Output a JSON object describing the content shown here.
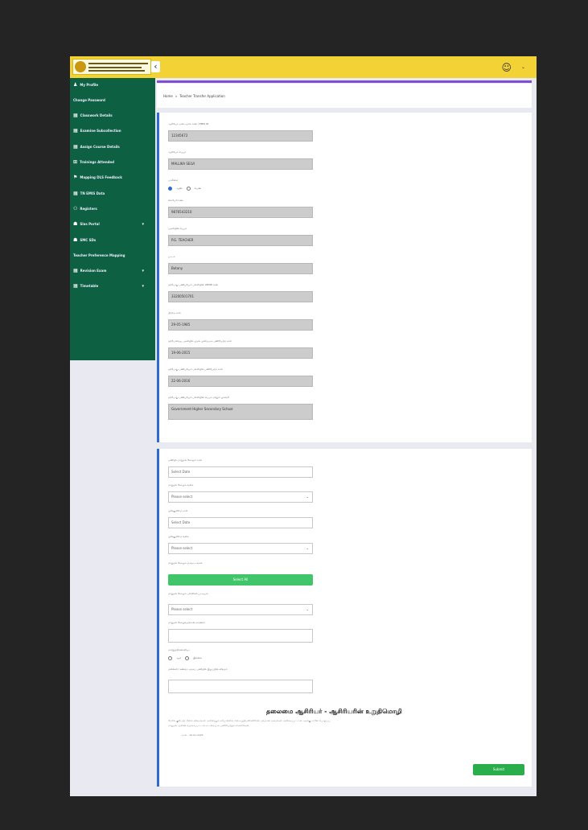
{
  "header": {
    "collapse_icon": "chevron-left-icon",
    "user_icon": "user-circle-icon",
    "user_name": "",
    "user_menu_icon": "chevron-down-icon"
  },
  "sidebar": {
    "items": [
      {
        "label": "My Profile",
        "icon": "user-icon",
        "has_chevron": false
      },
      {
        "label": "Change Password",
        "icon": "",
        "has_chevron": false
      },
      {
        "label": "Classwork Details",
        "icon": "list-icon",
        "has_chevron": false
      },
      {
        "label": "Examine Subcollection",
        "icon": "list-icon",
        "has_chevron": false
      },
      {
        "label": "Assign Course Details",
        "icon": "list-icon",
        "has_chevron": false
      },
      {
        "label": "Trainings Attended",
        "icon": "grid-icon",
        "has_chevron": false
      },
      {
        "label": "Mapping DLS Feedback",
        "icon": "flag-icon",
        "has_chevron": false
      },
      {
        "label": "TN EMIS Data",
        "icon": "list-icon",
        "has_chevron": false
      },
      {
        "label": "Registers",
        "icon": "users-icon",
        "has_chevron": false
      },
      {
        "label": "Slas Portal",
        "icon": "cap-icon",
        "has_chevron": true
      },
      {
        "label": "SMC SDs",
        "icon": "cap-icon",
        "has_chevron": false
      },
      {
        "label": "Teacher Preference Mapping",
        "icon": "",
        "has_chevron": false
      },
      {
        "label": "Revision Exam",
        "icon": "list-icon",
        "has_chevron": true
      },
      {
        "label": "Timetable",
        "icon": "list-icon",
        "has_chevron": true
      }
    ]
  },
  "breadcrumb": {
    "home": "Home",
    "separator": "»",
    "current": "Teacher Transfer Application"
  },
  "panel1": {
    "fields": [
      {
        "label": "ஆசிரியர் அடையாள எண் / EMIS ID",
        "value": "12345672"
      },
      {
        "label": "ஆசிரியர் பெயர்",
        "value": "MALLIKA SELVI"
      },
      {
        "label": "பாலினம்",
        "radio": [
          "ஆண்",
          "பெண்"
        ],
        "selected": 0
      },
      {
        "label": "கைபேசி எண்",
        "value": "9876543210"
      },
      {
        "label": "பதவியின் பெயர்",
        "value": "P.G. TEACHER"
      },
      {
        "label": "பாடம்",
        "value": "Botany"
      },
      {
        "label": "தற்போது பணிபுரியும் பள்ளியின் UDISE எண்",
        "value": "33200501701"
      },
      {
        "label": "பிறந்த நாள்",
        "value": "29-05-1985"
      },
      {
        "label": "தற்போதைய பதவியில் முதல் முறையாக பணியேற்ற நாள்",
        "value": "19-06-2015"
      },
      {
        "label": "தற்போது பணிபுரியும் பள்ளியில் பணியேற்ற நாள்",
        "value": "22-06-2016"
      },
      {
        "label": "தற்போது பணிபுரியும் பள்ளியின் பெயர் மற்றும் முகவரி",
        "value": "Government Higher Secondary School"
      }
    ]
  },
  "panel2": {
    "f1_label": "பணியிடமாறுதல் கோரும் நாள்",
    "f1_value": "Select Date",
    "f2_label": "மாறுதல் கோரும் வகை",
    "f2_value": "Please select",
    "f3_label": "முன்னுரிமை நாள்",
    "f3_value": "Select Date",
    "f4_label": "முன்னுரிமை வகை",
    "f4_value": "Please select",
    "f5_label": "மாறுதல் கோரும் மாவட்டங்கள்",
    "f5_button": "Select All",
    "f6_label": "மாறுதல் கோரும் பள்ளிகள் பட்டியல்",
    "f6_value": "Please select",
    "f7_label": "மாறுதல் கோருவதற்கான காரணம்",
    "f8_label": "மாற்றுத்திறனாளியா",
    "f8_radio": [
      "ஆம்",
      "இல்லை"
    ],
    "f9_label": "மனைவி / கணவர் அரசுப் பணியில் இருப்பின் விவரம்",
    "declaration_title": "தலைமை ஆசிரியர் - ஆசிரியரின் உறுதிமொழி",
    "declaration_line1": "மேலே குறிப்பிட்டுள்ள விவரங்கள் அனைத்தும் சரியானவை என உறுதியளிக்கிறேன். தவறான தகவல்கள் அளிக்கப்பட்டால் அதற்கு நானே பொறுப்பு.",
    "declaration_line2": "மாறுதல் ஆணை வழங்கப்பட்டால் உடனடியாக பணியேற்றுக் கொள்வேன்.",
    "declaration_date_label": "நாள் :",
    "declaration_date": "16-01-2025",
    "submit_label": "Submit"
  }
}
